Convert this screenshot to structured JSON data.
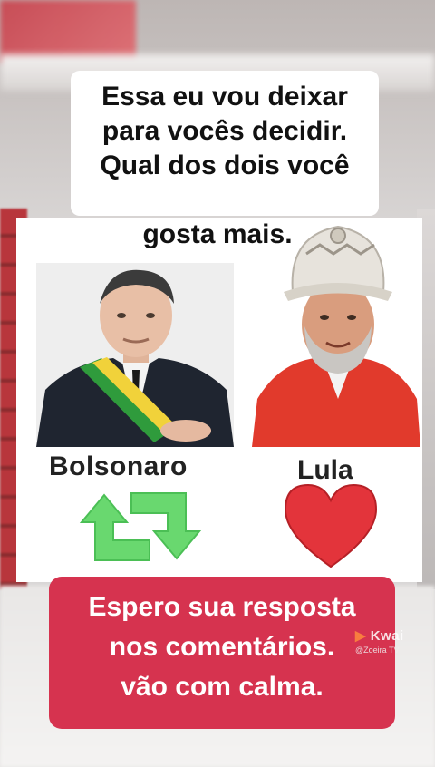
{
  "top_caption": {
    "lines": [
      "Essa eu vou deixar",
      "para vocês decidir.",
      "Qual dos dois você",
      "gosta mais."
    ]
  },
  "card": {
    "left": {
      "name": "Bolsonaro",
      "symbol": "retweet-arrows-icon",
      "symbol_color": "#69d86f"
    },
    "right": {
      "name": "Lula",
      "symbol": "heart-icon",
      "symbol_color": "#e3343b"
    }
  },
  "bottom_caption": {
    "lines": [
      "Espero sua resposta",
      "nos comentários.",
      "vão com calma."
    ],
    "background": "#d6334f"
  },
  "watermark": {
    "logo": "Kwai",
    "user": "@Zoeira TV"
  }
}
